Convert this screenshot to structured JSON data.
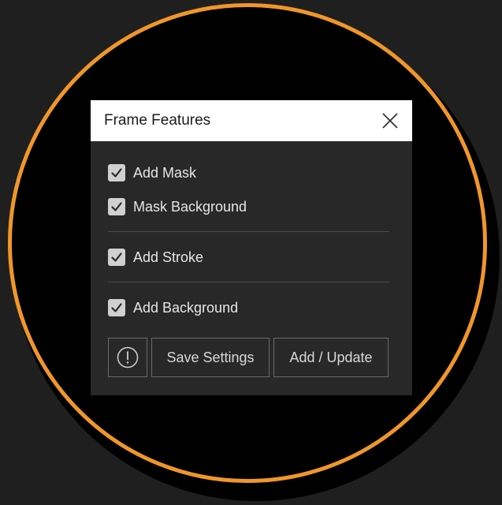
{
  "dialog": {
    "title": "Frame Features",
    "close_icon": "close-icon"
  },
  "options": [
    {
      "label": "Add Mask",
      "checked": true
    },
    {
      "label": "Mask Background",
      "checked": true
    },
    {
      "label": "Add Stroke",
      "checked": true
    },
    {
      "label": "Add Background",
      "checked": true
    }
  ],
  "buttons": {
    "info_icon": "info-icon",
    "save_label": "Save Settings",
    "add_label": "Add / Update"
  },
  "colors": {
    "ring": "#f0962a",
    "panel": "#282828",
    "header": "#ffffff",
    "checkbox": "#d0d0d0"
  }
}
